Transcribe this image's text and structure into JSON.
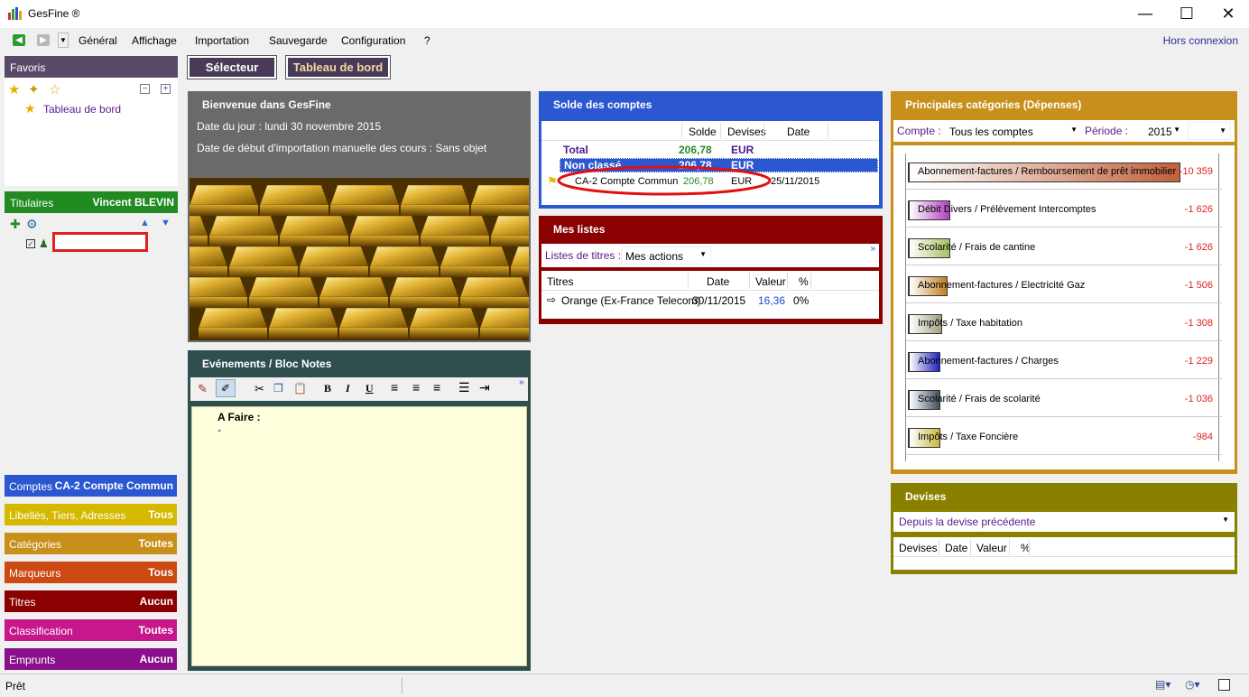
{
  "app": {
    "title": "GesFine ®",
    "window_buttons": {
      "minimize": "—",
      "maximize": "☐",
      "close": "✕"
    }
  },
  "menu": {
    "items": [
      "Général",
      "Affichage",
      "Importation",
      "Sauvegarde",
      "Configuration",
      "?"
    ],
    "connection": "Hors connexion"
  },
  "toolbar": {
    "selector": "Sélecteur",
    "dashboard": "Tableau de bord"
  },
  "favorites": {
    "header": "Favoris",
    "item": "Tableau de bord",
    "collapse": "−",
    "expand": "+"
  },
  "holders": {
    "label": "Titulaires",
    "name": "Vincent BLEVIN",
    "input_value": ""
  },
  "sidebar_filters": [
    {
      "label": "Comptes",
      "value": "CA-2 Compte Commun",
      "color": "#2b57d0"
    },
    {
      "label": "Libellés, Tiers, Adresses",
      "value": "Tous",
      "color": "#d6b800"
    },
    {
      "label": "Catégories",
      "value": "Toutes",
      "color": "#c8901a"
    },
    {
      "label": "Marqueurs",
      "value": "Tous",
      "color": "#cc4a12"
    },
    {
      "label": "Titres",
      "value": "Aucun",
      "color": "#8b0000"
    },
    {
      "label": "Classification",
      "value": "Toutes",
      "color": "#c7178c"
    },
    {
      "label": "Emprunts",
      "value": "Aucun",
      "color": "#8a0f8a"
    }
  ],
  "welcome": {
    "title": "Bienvenue dans GesFine",
    "date_line": "Date du jour : lundi 30 novembre 2015",
    "import_line": "Date de début d'importation manuelle des cours : Sans objet"
  },
  "events": {
    "title": "Evénements / Bloc Notes",
    "note_title": "A Faire :",
    "note_line": "-"
  },
  "balances": {
    "title": "Solde des comptes",
    "columns": [
      "Solde",
      "Devises",
      "Date"
    ],
    "total": {
      "label": "Total",
      "solde": "206,78",
      "devise": "EUR"
    },
    "group": {
      "label": "Non classé",
      "solde": "206,78",
      "devise": "EUR"
    },
    "account": {
      "label": "CA-2 Compte Commun",
      "solde": "206,78",
      "devise": "EUR",
      "date": "25/11/2015"
    }
  },
  "lists": {
    "title": "Mes listes",
    "filter_label": "Listes de titres :",
    "filter_value": "Mes actions",
    "more": "»",
    "columns": [
      "Titres",
      "Date",
      "Valeur",
      "%"
    ],
    "rows": [
      {
        "title": "Orange (Ex-France Telecom)",
        "date": "30/11/2015",
        "value": "16,36",
        "pct": "0%"
      }
    ]
  },
  "categories": {
    "title": "Principales catégories (Dépenses)",
    "account_label": "Compte :",
    "account_value": "Tous les comptes",
    "period_label": "Période :",
    "period_value": "2015",
    "items": [
      {
        "label": "Abonnement-factures / Remboursement de prêt immobilier",
        "value": "-10 359",
        "fill": 1.0,
        "color": "#c0603a"
      },
      {
        "label": "Débit Divers / Prélèvement Intercomptes",
        "value": "-1 626",
        "fill": 0.157,
        "color": "#b040c0"
      },
      {
        "label": "Scolarité / Frais de cantine",
        "value": "-1 626",
        "fill": 0.157,
        "color": "#a8c060"
      },
      {
        "label": "Abonnement-factures / Electricité Gaz",
        "value": "-1 506",
        "fill": 0.145,
        "color": "#c08020"
      },
      {
        "label": "Impôts / Taxe habitation",
        "value": "-1 308",
        "fill": 0.126,
        "color": "#a0a080"
      },
      {
        "label": "Abonnement-factures / Charges",
        "value": "-1 229",
        "fill": 0.119,
        "color": "#2020c0"
      },
      {
        "label": "Scolarité / Frais de scolarité",
        "value": "-1 036",
        "fill": 0.1,
        "color": "#405060"
      },
      {
        "label": "Impôts / Taxe Foncière",
        "value": "-984",
        "fill": 0.095,
        "color": "#c8b840"
      }
    ]
  },
  "currencies": {
    "title": "Devises",
    "select_value": "Depuis la devise précédente",
    "columns": [
      "Devises",
      "Date",
      "Valeur",
      "%"
    ]
  },
  "status": {
    "text": "Prêt"
  },
  "colors": {
    "balances_border": "#2b57d0",
    "lists_border": "#8b0000",
    "categories_border": "#c8901a",
    "currencies_border": "#8a8000",
    "events_border": "#2f4f4f",
    "welcome_bg": "#6a6a6a"
  }
}
